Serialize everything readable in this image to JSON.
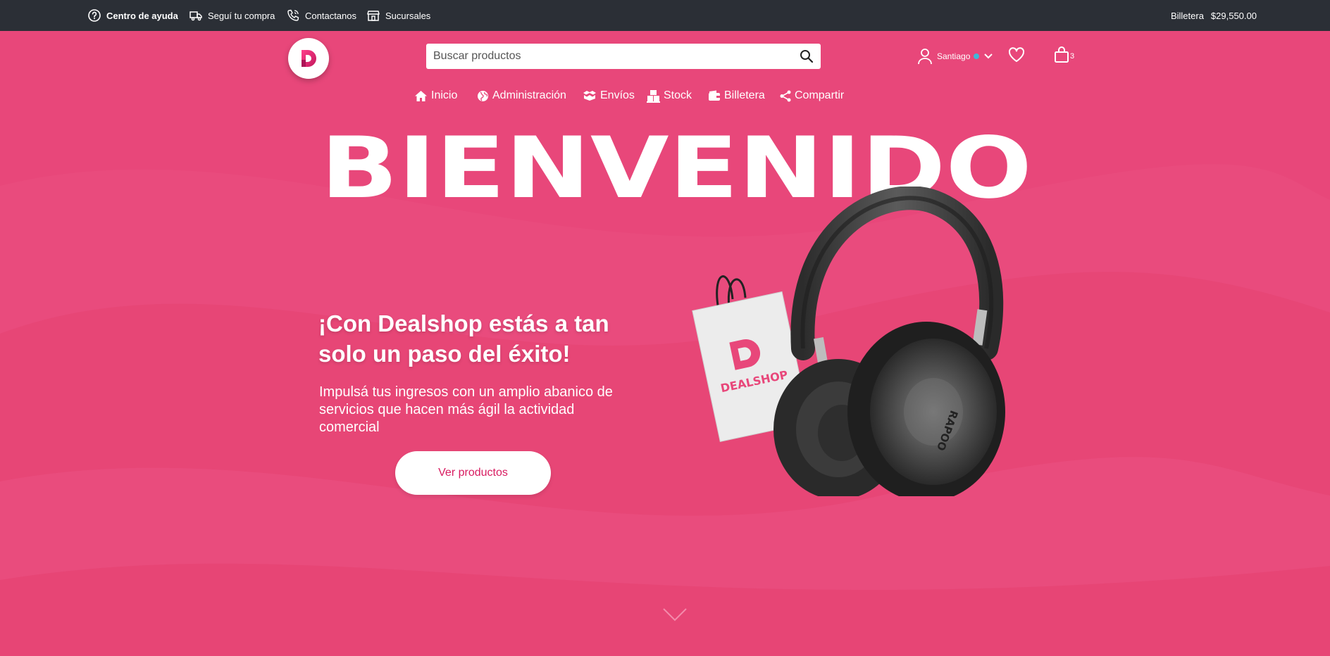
{
  "topbar": {
    "help": "Centro de ayuda",
    "track": "Seguí tu compra",
    "contact": "Contactanos",
    "branches": "Sucursales",
    "wallet_label": "Billetera",
    "wallet_amount": "$29,550.00"
  },
  "header": {
    "search_placeholder": "Buscar productos",
    "user_name": "Santiago",
    "cart_count": "3"
  },
  "nav": {
    "items": [
      {
        "label": "Inicio",
        "icon": "home-icon"
      },
      {
        "label": "Administración",
        "icon": "globe-icon"
      },
      {
        "label": "Envíos",
        "icon": "boxes-icon"
      },
      {
        "label": "Stock",
        "icon": "stock-icon"
      },
      {
        "label": "Billetera",
        "icon": "wallet-icon"
      },
      {
        "label": "Compartir",
        "icon": "share-icon"
      }
    ]
  },
  "hero": {
    "big_title": "BIENVENIDO",
    "headline": "¡Con Dealshop estás a tan solo un paso del éxito!",
    "subline": "Impulsá tus ingresos con un amplio abanico de servicios que hacen más ágil la actividad comercial",
    "cta_label": "Ver productos",
    "bag_brand": "DEALSHOP",
    "headphone_brand": "RAPOO"
  },
  "colors": {
    "brand_pink": "#e8477a",
    "topbar": "#2b2f36",
    "accent_text": "#d81b60",
    "status_dot": "#3fb7d8"
  }
}
